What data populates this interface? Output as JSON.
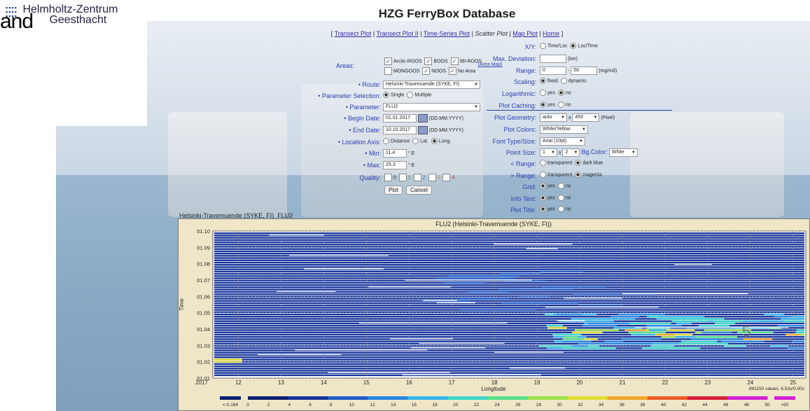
{
  "logo": {
    "line1": "Helmholtz-Zentrum",
    "line2": "Geesthacht"
  },
  "overlay_text": "and",
  "page_title": "HZG FerryBox Database",
  "nav": {
    "transect_plot": "Transect Plot",
    "transect_plot_2": "Transect Plot II",
    "time_series": "Time-Series Plot",
    "scatter": "Scatter Plot",
    "map_plot": "Map Plot",
    "home": "Home"
  },
  "form_left": {
    "areas_label": "Areas:",
    "areas": [
      {
        "name": "Arctic-ROOS",
        "checked": true
      },
      {
        "name": "BOOS",
        "checked": true
      },
      {
        "name": "IBI-ROOS",
        "checked": true
      },
      {
        "name": "MONGOOS",
        "checked": false
      },
      {
        "name": "NOOS",
        "checked": true
      },
      {
        "name": "No Area",
        "checked": true
      }
    ],
    "area_map_link": "[Area Map]",
    "route_label": "• Route:",
    "route_value": "Helsinki-Travemuende (SYKE, FI)",
    "param_sel_label": "• Parameter Selection:",
    "param_sel_single": "Single",
    "param_sel_multiple": "Multiple",
    "parameter_label": "• Parameter:",
    "parameter_value": "FLU2",
    "begin_label": "• Begin Date:",
    "begin_value": "01.01.2017",
    "end_label": "• End Date:",
    "end_value": "10.10.2017",
    "date_format": "(DD.MM.YYYY)",
    "loc_axis_label": "• Location Axis:",
    "loc_distance": "Distance",
    "loc_lat": "Lat.",
    "loc_long": "Long.",
    "min_label": "• Min:",
    "min_value": "11.4",
    "max_label": "• Max:",
    "max_value": "25.3",
    "unit_e": "° E",
    "quality_label": "Quality:",
    "quality_values": [
      "0",
      "1",
      "2",
      "3",
      "4"
    ],
    "plot_btn": "Plot",
    "cancel_btn": "Cancel"
  },
  "form_right": {
    "xy_label": "X/Y:",
    "xy_time_loc": "Time/Loc",
    "xy_loc_time": "Loc/Time",
    "max_dev_label": "Max. Deviation:",
    "max_dev_unit": "(km)",
    "range_label": "Range:",
    "range_min": "0",
    "range_max": "50",
    "range_unit": "(mg/m3)",
    "scaling_label": "Scaling:",
    "scaling_fixed": "fixed",
    "scaling_dynamic": "dynamic",
    "log_label": "Logarithmic:",
    "yes": "yes",
    "no": "no",
    "caching_label": "Plot Caching:",
    "geometry_label": "Plot Geometry:",
    "geometry_w": "auto",
    "geometry_x": "x",
    "geometry_h": "450",
    "geometry_unit": "(Pixel)",
    "colors_label": "Plot Colors:",
    "colors_value": "White/Yellow",
    "font_label": "Font Type/Size:",
    "font_value": "Arial (10pt)",
    "point_label": "Point Size:",
    "point_w": "1",
    "point_x": "x",
    "point_h": "2",
    "bg_label": "Bg.Color:",
    "bg_value": "White",
    "lt_range_label": "< Range:",
    "gt_range_label": "> Range:",
    "transparent": "transparent",
    "dark_blue": "dark blue",
    "magenta": "magenta",
    "grid_label": "Grid:",
    "info_label": "Info Text:",
    "title_label": "Plot Title:"
  },
  "plot": {
    "caption": "Helsinki-Travemuende (SYKE, FI)_FLU2",
    "footer_info": "891150 values, 6.53s/0.00s",
    "watermark": "5"
  },
  "chart_data": {
    "type": "heatmap",
    "title": "FLU2 (Helsinki-Travemuende (SYKE, FI))",
    "xlabel": "Longitude",
    "ylabel": "Time",
    "x_ticks": [
      12,
      13,
      14,
      15,
      16,
      17,
      18,
      19,
      20,
      21,
      22,
      23,
      24,
      25
    ],
    "x_extra_label": "2017",
    "xlim": [
      11.4,
      25.3
    ],
    "y_ticks": [
      "01.01",
      "01.02",
      "01.03",
      "01.04",
      "01.05",
      "01.06",
      "01.07",
      "01.08",
      "01.09",
      "01.10"
    ],
    "grid": true,
    "colorbar": {
      "ticks": [
        "<-0.184",
        "0",
        "2",
        "4",
        "6",
        "8",
        "10",
        "12",
        "14",
        "16",
        "18",
        "20",
        "22",
        "24",
        "26",
        "28",
        "30",
        "32",
        "34",
        "36",
        "38",
        "40",
        "42",
        "44",
        "46",
        "48",
        "50",
        ">50"
      ],
      "colors": [
        "#0b1f6e",
        "#14329a",
        "#1f5bc8",
        "#2b86e0",
        "#34b4e8",
        "#3bd6c8",
        "#55e08a",
        "#9be24a",
        "#e0dd33",
        "#f3a52a",
        "#ee5a25",
        "#d81e3a",
        "#d51fd4"
      ]
    }
  }
}
